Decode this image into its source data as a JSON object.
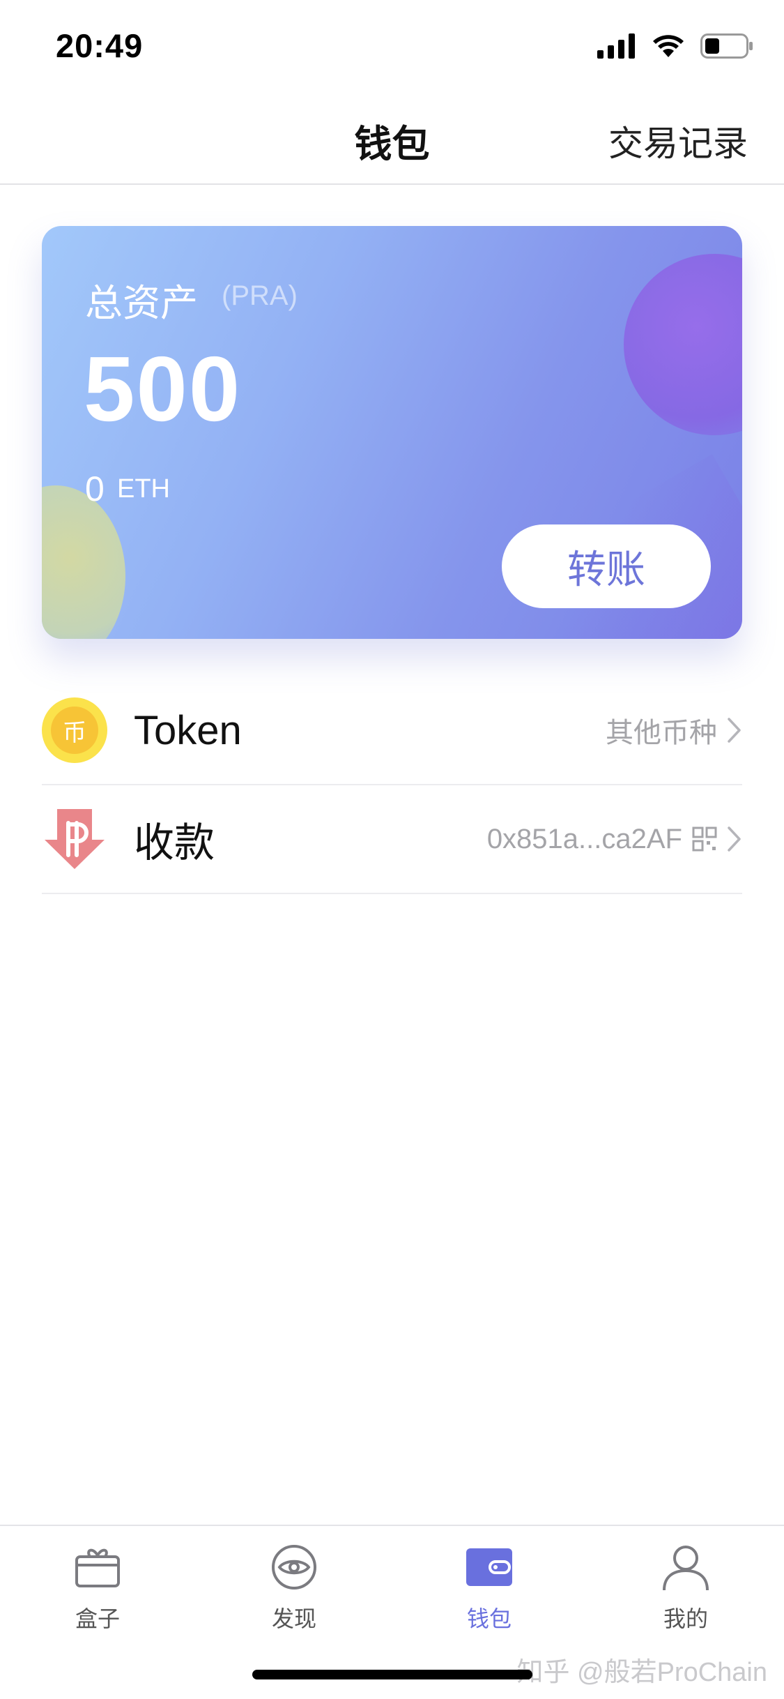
{
  "status_bar": {
    "time": "20:49"
  },
  "nav": {
    "title": "钱包",
    "right_action": "交易记录"
  },
  "asset_card": {
    "label": "总资产",
    "unit": "(PRA)",
    "value": "500",
    "eth_value": "0",
    "eth_unit": "ETH",
    "transfer_label": "转账"
  },
  "list": {
    "items": [
      {
        "label": "Token",
        "right_text": "其他币种",
        "icon": "coin-icon",
        "icon_glyph": "币"
      },
      {
        "label": "收款",
        "right_text": "0x851a...ca2AF",
        "icon": "receive-arrow-icon"
      }
    ]
  },
  "tabs": [
    {
      "label": "盒子",
      "icon": "gift-box-icon",
      "active": false
    },
    {
      "label": "发现",
      "icon": "eye-icon",
      "active": false
    },
    {
      "label": "钱包",
      "icon": "wallet-icon",
      "active": true
    },
    {
      "label": "我的",
      "icon": "user-icon",
      "active": false
    }
  ],
  "watermark": "知乎 @般若ProChain",
  "colors": {
    "accent": "#6970de",
    "card_start": "#a2c8fa",
    "card_end": "#7a80e7",
    "coin": "#fbe24b"
  }
}
